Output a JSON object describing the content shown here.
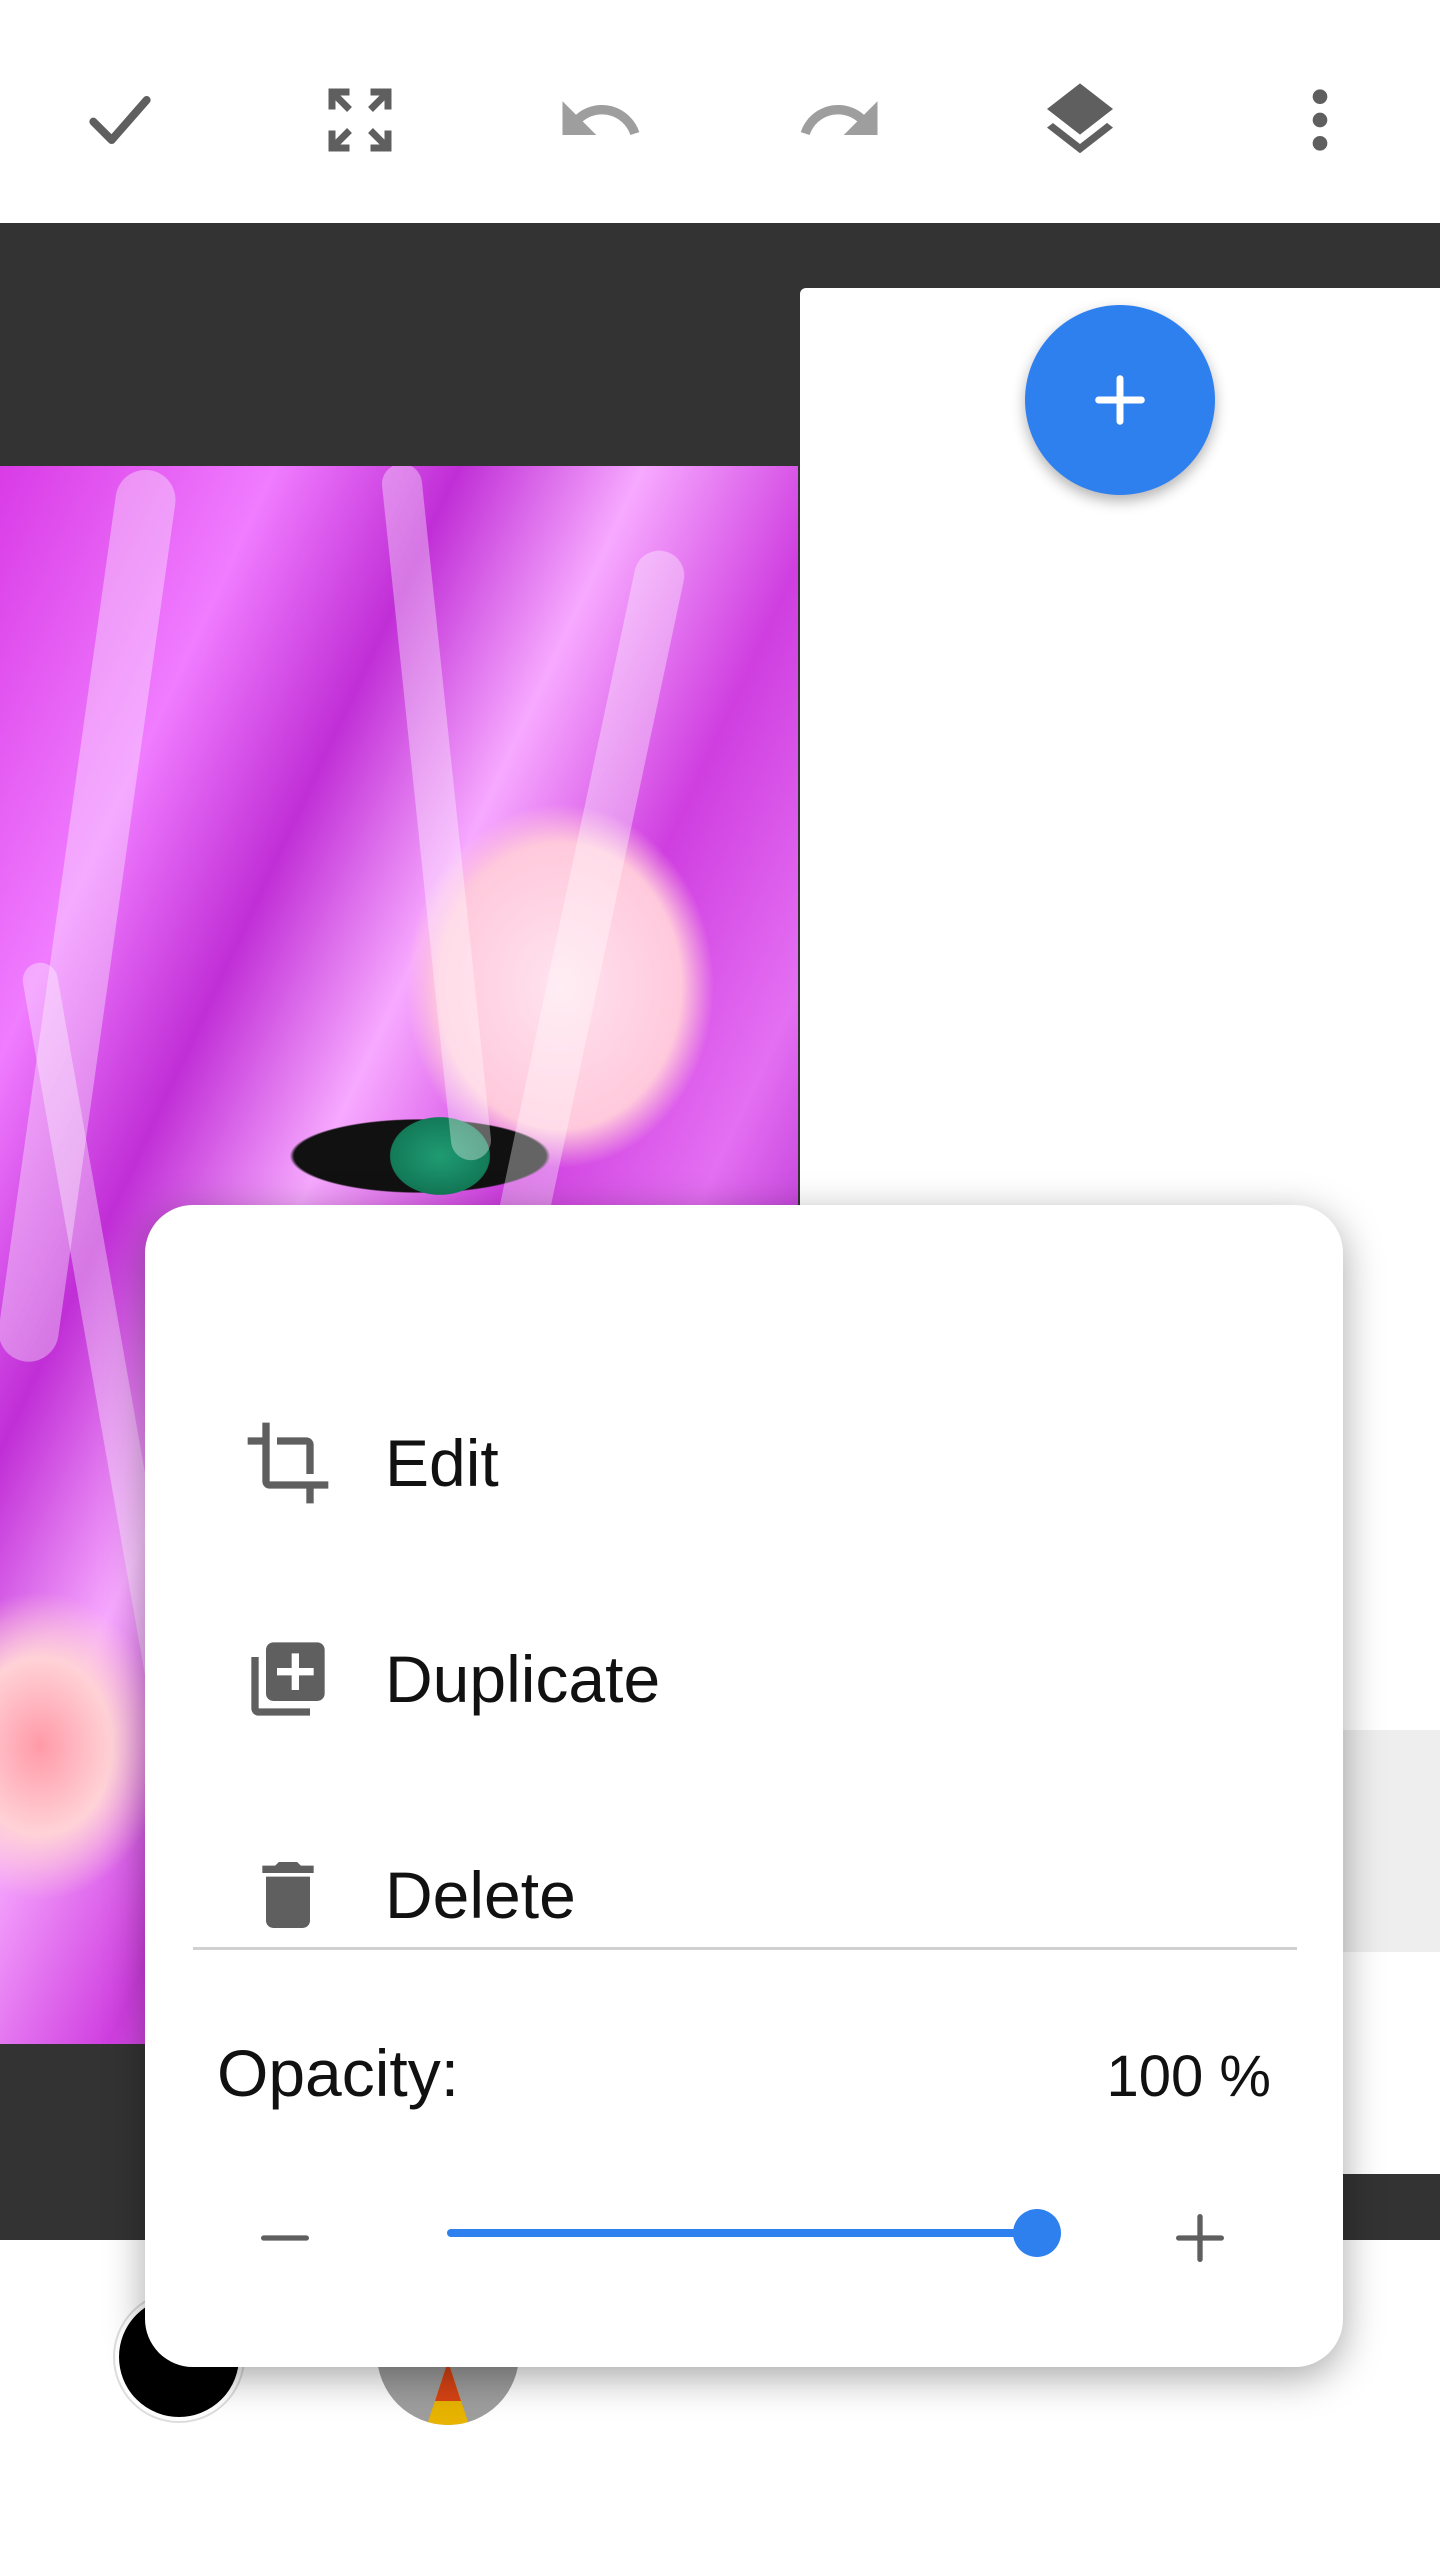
{
  "toolbar": {
    "icons": [
      "check-icon",
      "fullscreen-icon",
      "undo-icon",
      "redo-icon",
      "layers-icon",
      "more-vert-icon"
    ]
  },
  "layers": {
    "add_icon": "plus-icon"
  },
  "menu": {
    "items": [
      {
        "label": "Edit",
        "icon": "crop-icon"
      },
      {
        "label": "Duplicate",
        "icon": "library-add-icon"
      },
      {
        "label": "Delete",
        "icon": "trash-icon"
      }
    ],
    "opacity_label": "Opacity:",
    "opacity_value": "100 %",
    "opacity_fraction": 1.0
  },
  "colors": {
    "accent": "#2f80ef",
    "workspace": "#333333",
    "icon_gray": "#5f5f5f"
  }
}
